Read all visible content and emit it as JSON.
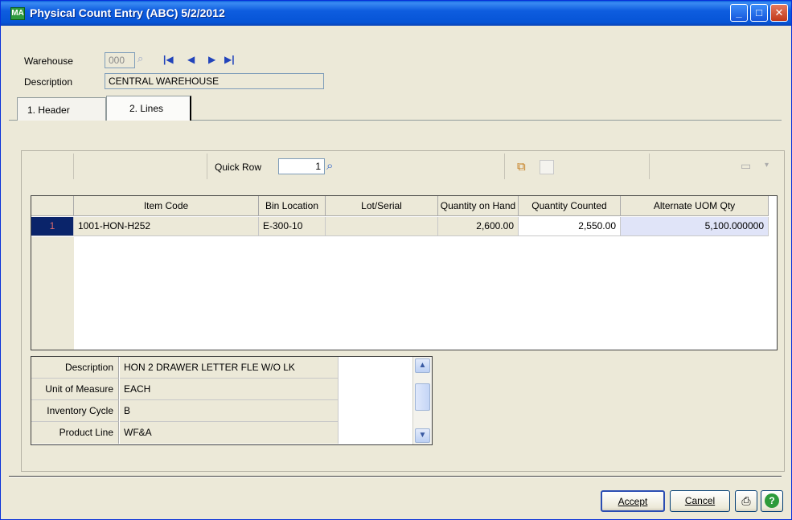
{
  "window": {
    "title": "Physical Count Entry (ABC) 5/2/2012",
    "app_icon": "MA"
  },
  "titlebar_buttons": {
    "minimize": "_",
    "maximize": "□",
    "close": "✕"
  },
  "header_fields": {
    "warehouse_label": "Warehouse",
    "warehouse_value": "000",
    "description_label": "Description",
    "description_value": "CENTRAL WAREHOUSE"
  },
  "tabs": [
    {
      "label": "1. Header",
      "active": false
    },
    {
      "label": "2. Lines",
      "active": true
    }
  ],
  "toolbar": {
    "quick_row_label": "Quick Row",
    "quick_row_value": "1"
  },
  "grid": {
    "columns": [
      "",
      "Item Code",
      "Bin Location",
      "Lot/Serial",
      "Quantity on Hand",
      "Quantity Counted",
      "Alternate UOM Qty"
    ],
    "rows": [
      {
        "row": "1",
        "item_code": "1001-HON-H252",
        "bin_location": "E-300-10",
        "lot_serial": "",
        "qty_on_hand": "2,600.00",
        "qty_counted": "2,550.00",
        "alt_uom_qty": "5,100.000000"
      }
    ]
  },
  "details": [
    {
      "label": "Description",
      "value": "HON 2 DRAWER LETTER FLE W/O LK"
    },
    {
      "label": "Unit of Measure",
      "value": "EACH"
    },
    {
      "label": "Inventory Cycle",
      "value": "B"
    },
    {
      "label": "Product Line",
      "value": "WF&A"
    }
  ],
  "buttons": {
    "accept": "Accept",
    "cancel": "Cancel"
  },
  "colors": {
    "titlebar": "#0654d6",
    "row_highlight": "#e0e4f8",
    "row_marker": "#0a246a"
  }
}
